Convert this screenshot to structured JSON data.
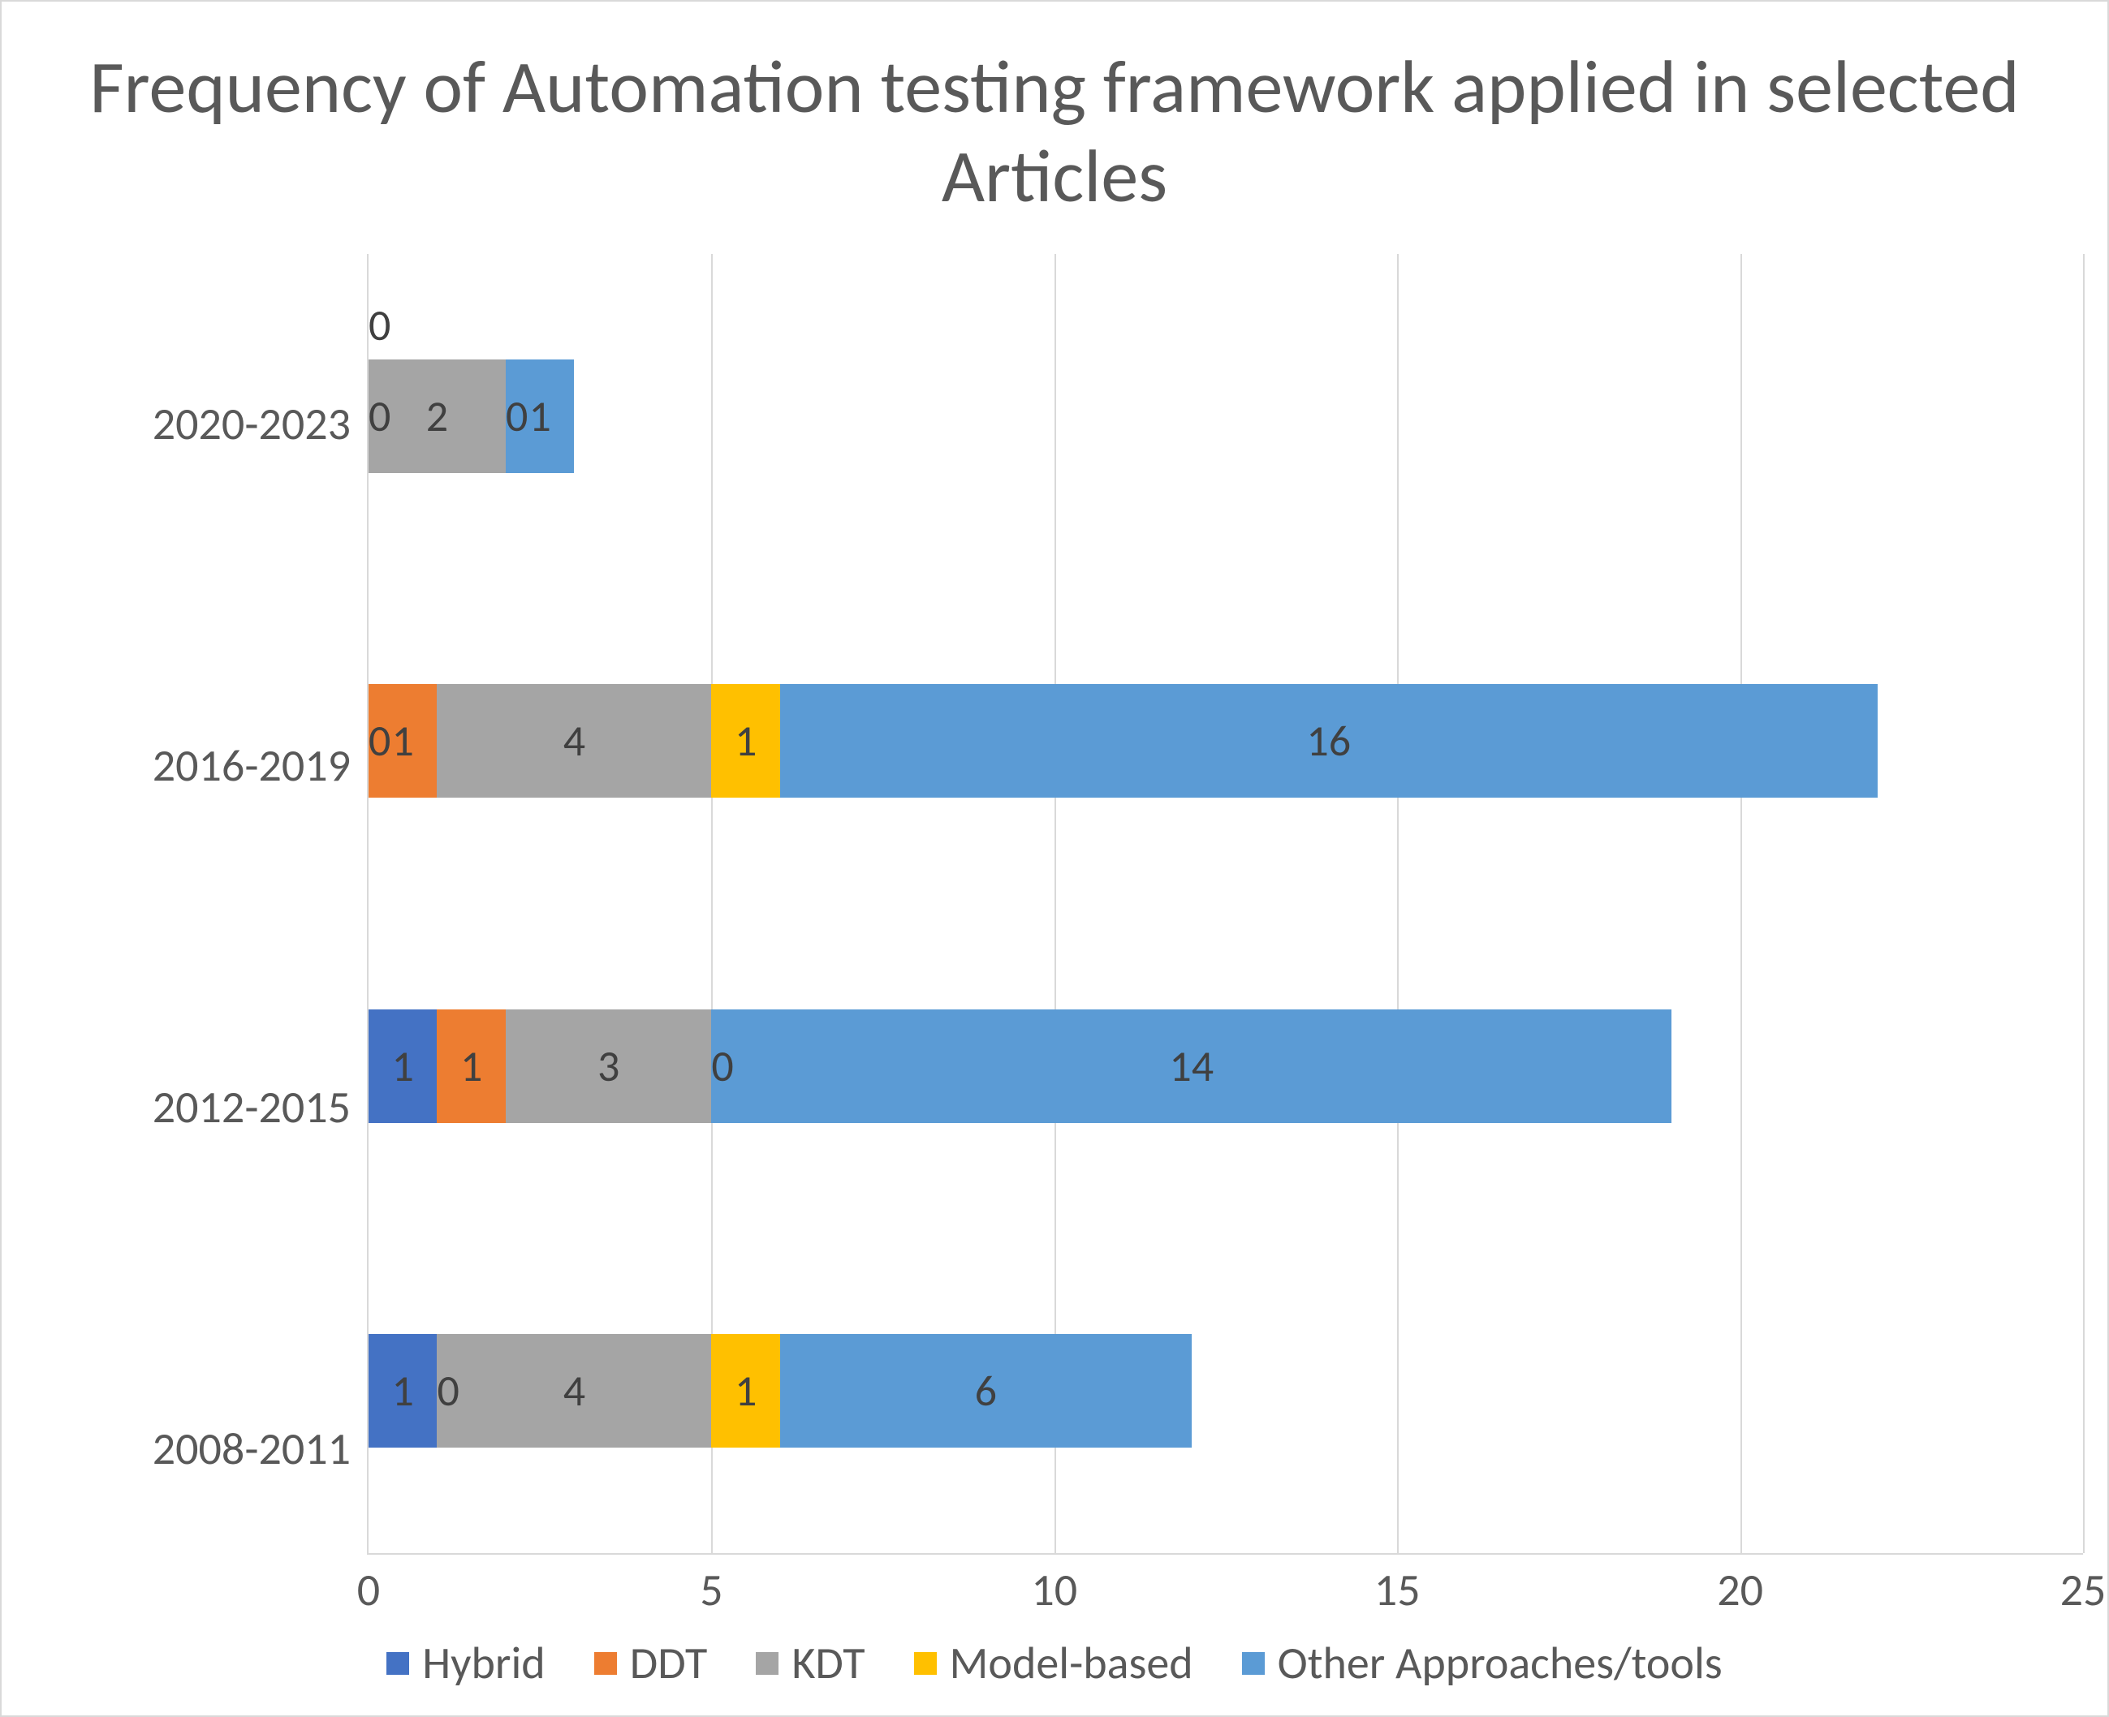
{
  "chart_data": {
    "type": "bar",
    "orientation": "horizontal",
    "stacked": true,
    "title": "Frequency of  Automation testing framework applied in selected Articles",
    "xlabel": "",
    "ylabel": "",
    "xlim": [
      0,
      25
    ],
    "xticks": [
      0,
      5,
      10,
      15,
      20,
      25
    ],
    "categories": [
      "2008-2011",
      "2012-2015",
      "2016-2019",
      "2020-2023"
    ],
    "series": [
      {
        "name": "Hybrid",
        "color": "#4472c4",
        "values": [
          1,
          1,
          0,
          0
        ]
      },
      {
        "name": "DDT",
        "color": "#ed7d31",
        "values": [
          0,
          1,
          1,
          0
        ]
      },
      {
        "name": "KDT",
        "color": "#a5a5a5",
        "values": [
          4,
          3,
          4,
          2
        ]
      },
      {
        "name": "Model-based",
        "color": "#ffc000",
        "values": [
          1,
          0,
          1,
          0
        ]
      },
      {
        "name": "Other Approaches/tools",
        "color": "#5b9bd5",
        "values": [
          6,
          14,
          16,
          1
        ]
      }
    ]
  }
}
